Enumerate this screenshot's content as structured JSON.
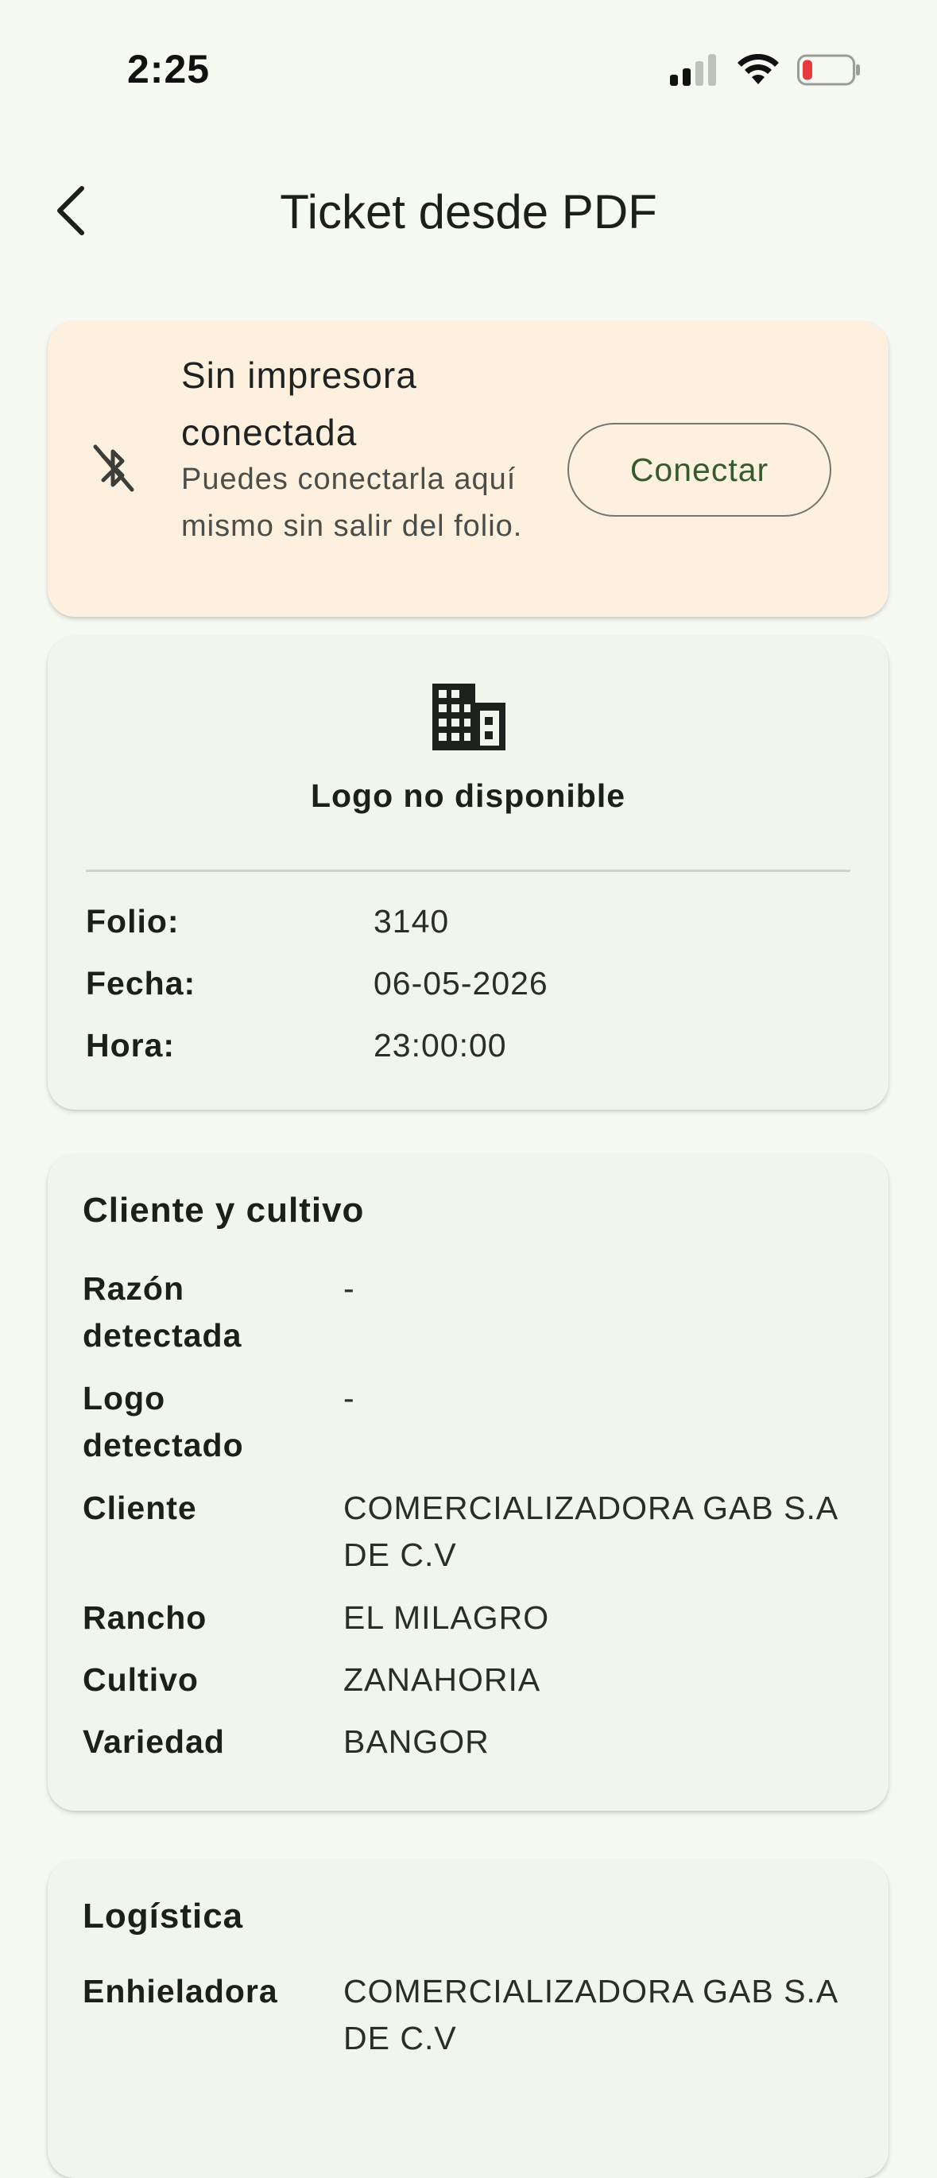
{
  "status_bar": {
    "time": "2:25",
    "icons": [
      "cellular-signal-icon",
      "wifi-icon",
      "battery-low-icon"
    ],
    "battery_color": "#e8393c"
  },
  "header": {
    "title": "Ticket desde PDF",
    "back_icon": "chevron-left-icon"
  },
  "printer_banner": {
    "icon": "bluetooth-disabled-icon",
    "title": "Sin impresora conectada",
    "subtitle": "Puedes conectarla aquí mismo sin salir del folio.",
    "button_label": "Conectar",
    "background": "#fef0df",
    "accent": "#355a2e"
  },
  "ticket_header": {
    "icon": "building-icon",
    "logo_caption": "Logo no disponible",
    "fields": [
      {
        "label": "Folio:",
        "value": "3140"
      },
      {
        "label": "Fecha:",
        "value": "06-05-2026"
      },
      {
        "label": "Hora:",
        "value": "23:00:00"
      }
    ]
  },
  "client_section": {
    "title": "Cliente y cultivo",
    "fields": [
      {
        "label": "Razón detectada",
        "value": "-"
      },
      {
        "label": "Logo detectado",
        "value": "-"
      },
      {
        "label": "Cliente",
        "value": "COMERCIALIZADORA GAB S.A DE C.V"
      },
      {
        "label": "Rancho",
        "value": "EL MILAGRO"
      },
      {
        "label": "Cultivo",
        "value": "ZANAHORIA"
      },
      {
        "label": "Variedad",
        "value": "BANGOR"
      }
    ]
  },
  "logistics_section": {
    "title": "Logística",
    "fields": [
      {
        "label": "Enhieladora",
        "value": "COMERCIALIZADORA GAB S.A DE C.V"
      }
    ]
  }
}
